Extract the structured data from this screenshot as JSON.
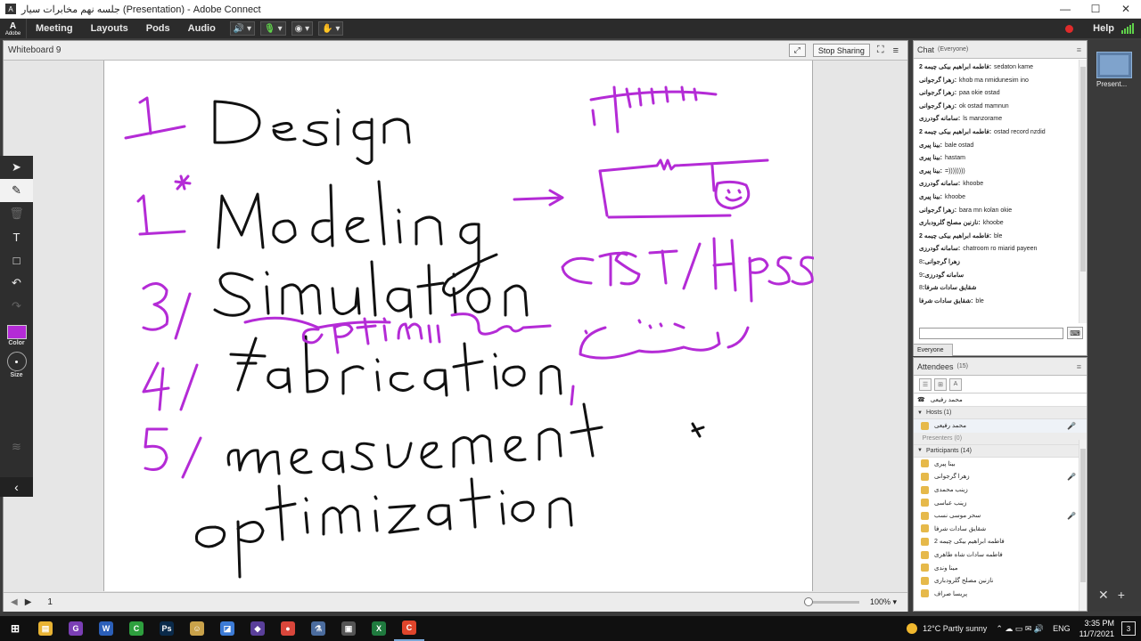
{
  "window": {
    "title": "جلسه نهم مخابرات سیار (Presentation) - Adobe Connect",
    "controls": [
      "—",
      "☐",
      "✕"
    ]
  },
  "menubar": {
    "logo_text": "Adobe",
    "items": [
      "Meeting",
      "Layouts",
      "Pods",
      "Audio"
    ],
    "help": "Help"
  },
  "whiteboard": {
    "title": "Whiteboard 9",
    "stop_sharing": "Stop Sharing",
    "page": "1",
    "zoom": "100%",
    "pen_color": "#b42bd6",
    "tool_color_label": "Color",
    "tool_size_label": "Size"
  },
  "chat": {
    "title": "Chat",
    "scope": "(Everyone)",
    "tab": "Everyone",
    "messages": [
      {
        "sender": "2 فاطمه ابراهیم بیکی چیمه:",
        "text": "sedaton kame"
      },
      {
        "sender": "زهرا گرجوانی:",
        "text": "khob ma nmidunesim ino"
      },
      {
        "sender": "زهرا گرجوانی:",
        "text": "paa okie ostad"
      },
      {
        "sender": "زهرا گرجوانی:",
        "text": "ok ostad mamnun"
      },
      {
        "sender": "سامانه گودرزی:",
        "text": "ls  manzorame"
      },
      {
        "sender": "2 فاطمه ابراهیم بیکی چیمه:",
        "text": "ostad record nzdid"
      },
      {
        "sender": "بینا پیری:",
        "text": "bale ostad"
      },
      {
        "sender": "بینا پیری:",
        "text": "hastam"
      },
      {
        "sender": "بینا پیری:",
        "text": "=))))))))"
      },
      {
        "sender": "سامانه گودرزی:",
        "text": "khoobe"
      },
      {
        "sender": "بینا پیری:",
        "text": "khoobe"
      },
      {
        "sender": "زهرا گرجوانی:",
        "text": "bara mn kolan okie"
      },
      {
        "sender": "نازنین مصلح گلرودباری:",
        "text": "khoobe"
      },
      {
        "sender": "2 فاطمه ابراهیم بیکی چیمه:",
        "text": "ble"
      },
      {
        "sender": "سامانه گودرزی:",
        "text": "chatroom ro miarid payeen"
      },
      {
        "sender": "زهرا گرجوانی:",
        "text": "8"
      },
      {
        "sender": "سامانه گودرزی:",
        "text": "9"
      },
      {
        "sender": "شقایق سادات شرفا:",
        "text": "8"
      },
      {
        "sender": "شقایق سادات شرفا:",
        "text": "ble"
      }
    ]
  },
  "attendees": {
    "title": "Attendees",
    "count": "(15)",
    "me": "محمد رفیعی",
    "hosts_label": "Hosts (1)",
    "presenters_label": "Presenters (0)",
    "participants_label": "Participants (14)",
    "hosts": [
      {
        "name": "محمد رفیعی",
        "mic": true
      }
    ],
    "participants": [
      {
        "name": "بینا پیری",
        "mic": false
      },
      {
        "name": "زهرا گرجوانی",
        "mic": true
      },
      {
        "name": "زینب محمدی",
        "mic": false
      },
      {
        "name": "زینب عباسی",
        "mic": false
      },
      {
        "name": "سحر موسی نسب",
        "mic": true
      },
      {
        "name": "شقایق سادات شرفا",
        "mic": false
      },
      {
        "name": "فاطمه ابراهیم بیکی چیمه 2",
        "mic": false
      },
      {
        "name": "فاطمه سادات شاه طاهری",
        "mic": false
      },
      {
        "name": "مینا وندی",
        "mic": false
      },
      {
        "name": "نازنین مصلح گلرودباری",
        "mic": false
      },
      {
        "name": "پریسا صراف",
        "mic": false
      }
    ]
  },
  "side_strip": {
    "label": "Present..."
  },
  "taskbar": {
    "weather": "12°C  Partly sunny",
    "lang": "ENG",
    "time": "3:35 PM",
    "date": "11/7/2021",
    "notifications": "3",
    "apps": [
      {
        "name": "file-explorer-icon",
        "color": "#e8b333",
        "glyph": "▤"
      },
      {
        "name": "app-g-icon",
        "color": "#7b3fb5",
        "glyph": "G"
      },
      {
        "name": "word-icon",
        "color": "#2b5fb8",
        "glyph": "W"
      },
      {
        "name": "camtasia-icon",
        "color": "#2e9f3e",
        "glyph": "C"
      },
      {
        "name": "photoshop-icon",
        "color": "#0a2a4a",
        "glyph": "Ps"
      },
      {
        "name": "app-person-icon",
        "color": "#c9a24a",
        "glyph": "☺"
      },
      {
        "name": "app-blue-icon",
        "color": "#3c7bd6",
        "glyph": "◪"
      },
      {
        "name": "app-purple-icon",
        "color": "#5a3f9a",
        "glyph": "◆"
      },
      {
        "name": "chrome-icon",
        "color": "#d9463b",
        "glyph": "●"
      },
      {
        "name": "app-beaker-icon",
        "color": "#4b6c9e",
        "glyph": "⚗"
      },
      {
        "name": "app-camera-icon",
        "color": "#555555",
        "glyph": "▣"
      },
      {
        "name": "excel-icon",
        "color": "#1f7a3e",
        "glyph": "X"
      },
      {
        "name": "adobe-connect-icon",
        "color": "#e0452b",
        "glyph": "C"
      }
    ]
  }
}
